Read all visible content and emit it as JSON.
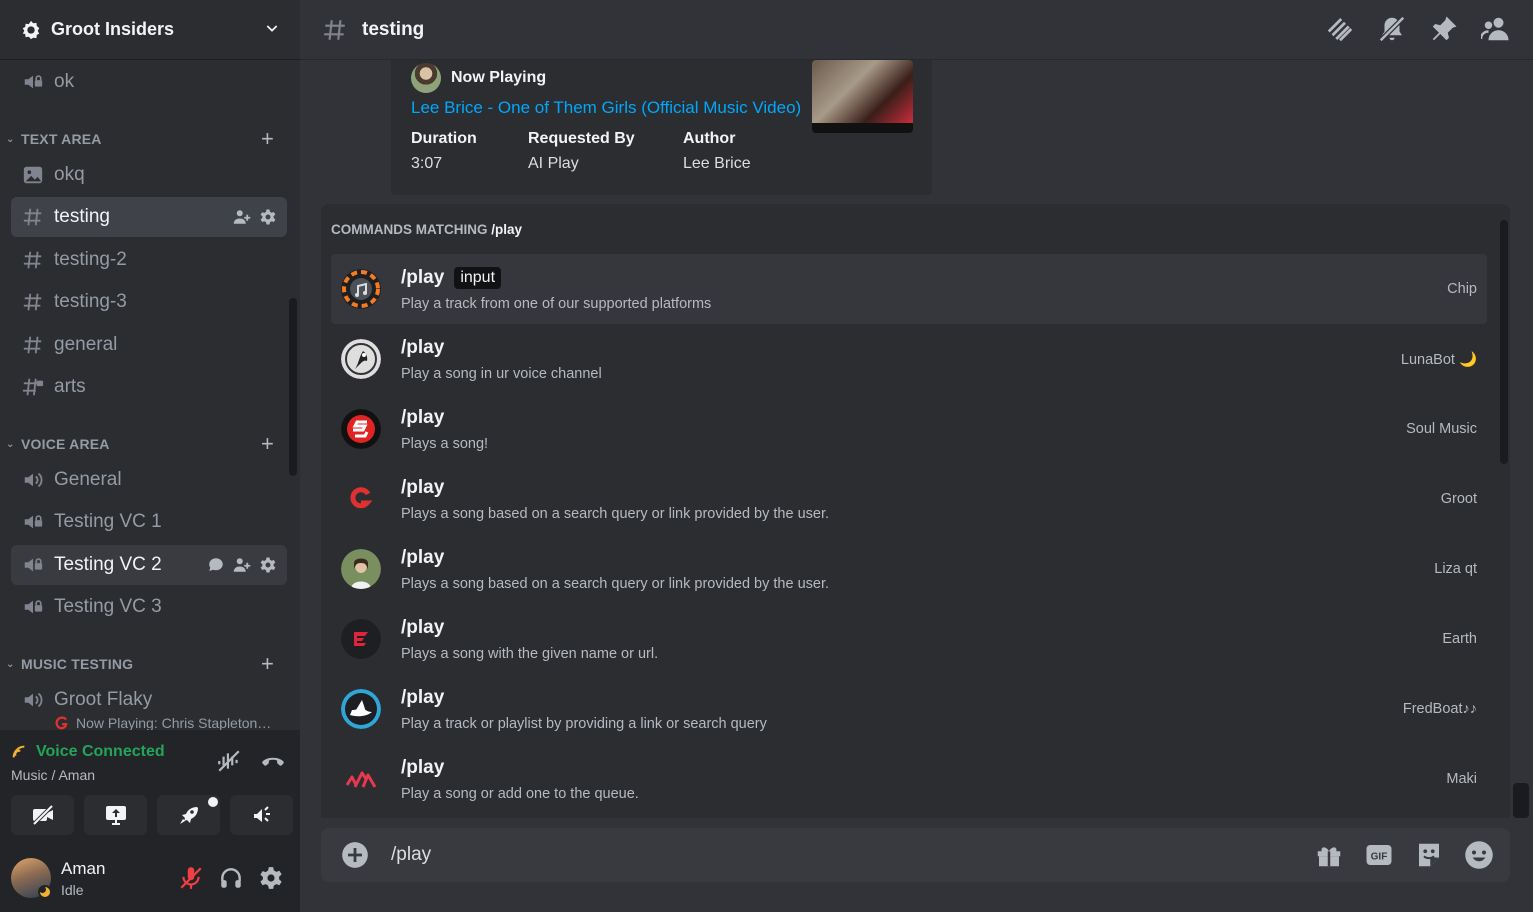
{
  "server": {
    "name": "Groot Insiders"
  },
  "channels": {
    "partial_top": {
      "name": "ok"
    },
    "categories": [
      {
        "label": "TEXT AREA"
      },
      {
        "label": "VOICE AREA"
      },
      {
        "label": "MUSIC TESTING"
      }
    ],
    "text": [
      {
        "name": "okq"
      },
      {
        "name": "testing"
      },
      {
        "name": "testing-2"
      },
      {
        "name": "testing-3"
      },
      {
        "name": "general"
      },
      {
        "name": "arts"
      }
    ],
    "voice": [
      {
        "name": "General"
      },
      {
        "name": "Testing VC 1"
      },
      {
        "name": "Testing VC 2"
      },
      {
        "name": "Testing VC 3"
      }
    ],
    "music": [
      {
        "name": "Groot Flaky",
        "activity": "Now Playing: Chris Stapleton…"
      }
    ]
  },
  "voice_panel": {
    "status": "Voice Connected",
    "location": "Music / Aman"
  },
  "user": {
    "name": "Aman",
    "status": "Idle"
  },
  "topbar": {
    "channel": "testing"
  },
  "embed": {
    "author": "Now Playing",
    "title": "Lee Brice - One of Them Girls (Official Music Video)",
    "fields": [
      {
        "name": "Duration",
        "value": "3:07"
      },
      {
        "name": "Requested By",
        "value": "AI Play"
      },
      {
        "name": "Author",
        "value": "Lee Brice"
      }
    ]
  },
  "commands": {
    "header_prefix": "COMMANDS MATCHING",
    "query": "/play",
    "items": [
      {
        "name": "/play",
        "option": "input",
        "desc": "Play a track from one of our supported platforms",
        "bot": "Chip"
      },
      {
        "name": "/play",
        "desc": "Play a song in ur voice channel",
        "bot": "LunaBot 🌙"
      },
      {
        "name": "/play",
        "desc": "Plays a song!",
        "bot": "Soul Music"
      },
      {
        "name": "/play",
        "desc": "Plays a song based on a search query or link provided by the user.",
        "bot": "Groot"
      },
      {
        "name": "/play",
        "desc": "Plays a song based on a search query or link provided by the user.",
        "bot": "Liza qt"
      },
      {
        "name": "/play",
        "desc": "Plays a song with the given name or url.",
        "bot": "Earth"
      },
      {
        "name": "/play",
        "desc": "Play a track or playlist by providing a link or search query",
        "bot": "FredBoat♪♪"
      },
      {
        "name": "/play",
        "desc": "Play a song or add one to the queue.",
        "bot": "Maki"
      }
    ]
  },
  "composer": {
    "value": "/play"
  },
  "colors": {
    "accent_link": "#00a8fc",
    "voice_connected": "#23a559",
    "idle": "#f0b232"
  }
}
